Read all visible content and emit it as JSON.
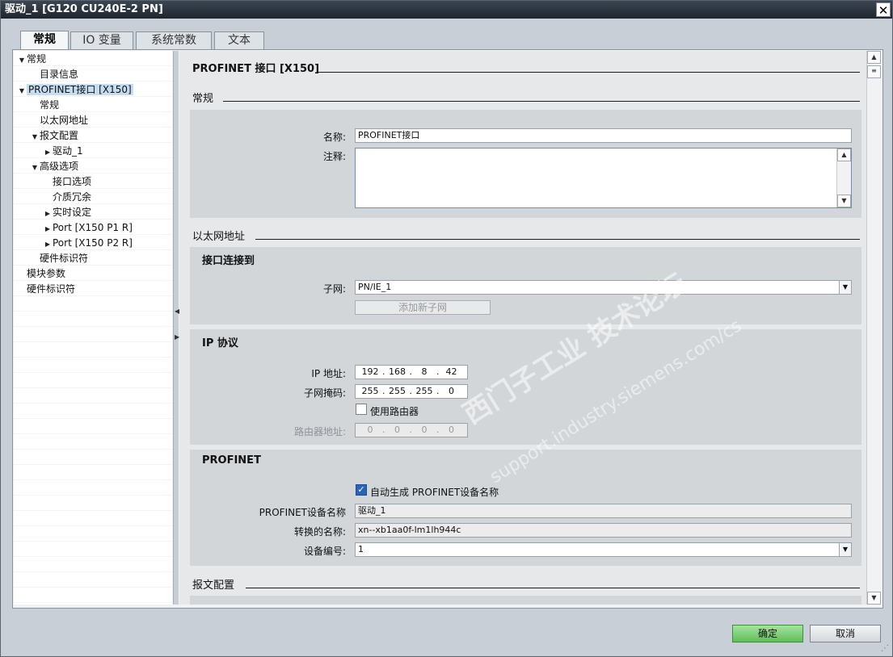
{
  "window": {
    "title": "驱动_1 [G120 CU240E-2 PN]",
    "close_glyph": "✕"
  },
  "tabs": [
    {
      "label": "常规",
      "active": true
    },
    {
      "label": "IO 变量",
      "active": false
    },
    {
      "label": "系统常数",
      "active": false
    },
    {
      "label": "文本",
      "active": false
    }
  ],
  "tree": {
    "items": [
      {
        "label": "常规",
        "level": 0,
        "arrow": "expanded"
      },
      {
        "label": "目录信息",
        "level": 1,
        "arrow": "none"
      },
      {
        "label": "PROFINET接口 [X150]",
        "level": 0,
        "arrow": "expanded",
        "selected": true
      },
      {
        "label": "常规",
        "level": 1,
        "arrow": "none"
      },
      {
        "label": "以太网地址",
        "level": 1,
        "arrow": "none"
      },
      {
        "label": "报文配置",
        "level": 1,
        "arrow": "expanded"
      },
      {
        "label": "驱动_1",
        "level": 2,
        "arrow": "collapsed"
      },
      {
        "label": "高级选项",
        "level": 1,
        "arrow": "expanded"
      },
      {
        "label": "接口选项",
        "level": 2,
        "arrow": "none"
      },
      {
        "label": "介质冗余",
        "level": 2,
        "arrow": "none"
      },
      {
        "label": "实时设定",
        "level": 2,
        "arrow": "collapsed"
      },
      {
        "label": "Port [X150 P1 R]",
        "level": 2,
        "arrow": "collapsed"
      },
      {
        "label": "Port [X150 P2 R]",
        "level": 2,
        "arrow": "collapsed"
      },
      {
        "label": "硬件标识符",
        "level": 1,
        "arrow": "none"
      },
      {
        "label": "模块参数",
        "level": 0,
        "arrow": "none"
      },
      {
        "label": "硬件标识符",
        "level": 0,
        "arrow": "none"
      }
    ]
  },
  "main": {
    "header": "PROFINET 接口 [X150]",
    "general": {
      "section": "常规",
      "name_label": "名称:",
      "name_value": "PROFINET接口",
      "comment_label": "注释:",
      "comment_value": ""
    },
    "ethernet": {
      "section": "以太网地址",
      "connect_title": "接口连接到",
      "subnet_label": "子网:",
      "subnet_value": "PN/IE_1",
      "add_subnet_label": "添加新子网",
      "ip_title": "IP 协议",
      "ip_label": "IP 地址:",
      "ip_value": [
        "192",
        "168",
        "8",
        "42"
      ],
      "mask_label": "子网掩码:",
      "mask_value": [
        "255",
        "255",
        "255",
        "0"
      ],
      "use_router_label": "使用路由器",
      "use_router_checked": false,
      "router_label": "路由器地址:",
      "router_value": [
        "0",
        "0",
        "0",
        "0"
      ]
    },
    "profinet": {
      "title": "PROFINET",
      "auto_name_label": "自动生成 PROFINET设备名称",
      "auto_name_checked": true,
      "device_name_label": "PROFINET设备名称",
      "device_name_value": "驱动_1",
      "converted_label": "转换的名称:",
      "converted_value": "xn--xb1aa0f-lm1lh944c",
      "device_number_label": "设备编号:",
      "device_number_value": "1"
    },
    "telegram": {
      "section": "报文配置"
    }
  },
  "footer": {
    "ok_label": "确定",
    "cancel_label": "取消"
  },
  "watermark": {
    "text": "西门子工业 技术论坛",
    "sub": "support.industry.siemens.com/cs"
  }
}
